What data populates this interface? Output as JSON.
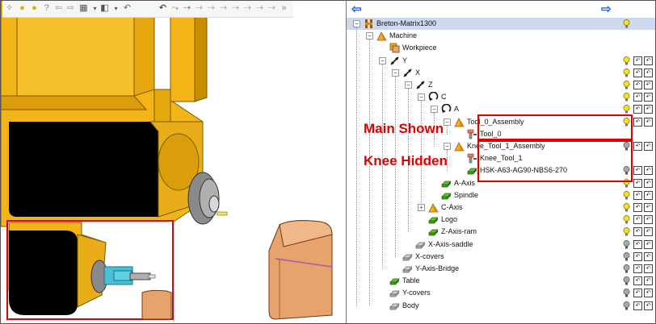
{
  "annotations": {
    "main_shown": "Main Shown",
    "knee_hidden": "Knee Hidden"
  },
  "toolbar": {
    "icons": [
      "camera-icon",
      "bulb-icon",
      "bulb-icon",
      "bulb-question-icon",
      "arrow-left-icon",
      "arrow-right-icon",
      "cube-grid-icon",
      "dropdown-arrow-icon",
      "select-cube-icon",
      "dropdown-arrow-icon",
      "undo-icon",
      "path-icon",
      "path-icon",
      "path-icon",
      "path-icon",
      "path-icon",
      "path-icon",
      "path-icon",
      "more-icon"
    ]
  },
  "tree": {
    "nav_back": "⇦",
    "nav_forward": "⇨",
    "nodes": [
      {
        "label": "Breton-Matrix1300",
        "icon": "machine-icon",
        "bulb": "on",
        "boxes": 0
      },
      {
        "label": "Machine",
        "icon": "component-icon",
        "bulb": "",
        "boxes": 0
      },
      {
        "label": "Workpiece",
        "icon": "workpiece-icon",
        "bulb": "",
        "boxes": 0
      },
      {
        "label": "Y",
        "icon": "linear-axis-icon",
        "bulb": "on",
        "boxes": 2
      },
      {
        "label": "X",
        "icon": "linear-axis-icon",
        "bulb": "on",
        "boxes": 2
      },
      {
        "label": "Z",
        "icon": "linear-axis-icon",
        "bulb": "on",
        "boxes": 2
      },
      {
        "label": "C",
        "icon": "rotary-axis-icon",
        "bulb": "on",
        "boxes": 2
      },
      {
        "label": "A",
        "icon": "rotary-axis-icon",
        "bulb": "on",
        "boxes": 2
      },
      {
        "label": "Tool_0_Assembly",
        "icon": "component-icon",
        "bulb": "on",
        "boxes": 2
      },
      {
        "label": "Tool_0",
        "icon": "tool-icon",
        "bulb": "",
        "boxes": 0
      },
      {
        "label": "Knee_Tool_1_Assembly",
        "icon": "component-icon",
        "bulb": "off",
        "boxes": 2
      },
      {
        "label": "Knee_Tool_1",
        "icon": "tool-icon",
        "bulb": "",
        "boxes": 0
      },
      {
        "label": "HSK-A63-AG90-NBS6-270",
        "icon": "green-solid-icon",
        "bulb": "off",
        "boxes": 2
      },
      {
        "label": "A-Axis",
        "icon": "green-solid-icon",
        "bulb": "on",
        "boxes": 2
      },
      {
        "label": "Spindle",
        "icon": "green-solid-icon",
        "bulb": "on",
        "boxes": 2
      },
      {
        "label": "C-Axis",
        "icon": "component-icon",
        "bulb": "on",
        "boxes": 2
      },
      {
        "label": "Logo",
        "icon": "green-solid-icon",
        "bulb": "on",
        "boxes": 2
      },
      {
        "label": "Z-Axis-ram",
        "icon": "green-solid-icon",
        "bulb": "on",
        "boxes": 2
      },
      {
        "label": "X-Axis-saddle",
        "icon": "grey-solid-icon",
        "bulb": "off",
        "boxes": 2
      },
      {
        "label": "X-covers",
        "icon": "grey-solid-icon",
        "bulb": "off",
        "boxes": 2
      },
      {
        "label": "Y-Axis-Bridge",
        "icon": "grey-solid-icon",
        "bulb": "off",
        "boxes": 2
      },
      {
        "label": "Table",
        "icon": "green-solid-icon",
        "bulb": "off",
        "boxes": 2
      },
      {
        "label": "Y-covers",
        "icon": "grey-solid-icon",
        "bulb": "off",
        "boxes": 2
      },
      {
        "label": "Body",
        "icon": "grey-solid-icon",
        "bulb": "off",
        "boxes": 2
      }
    ]
  },
  "colors": {
    "machine_yellow": "#f2b417",
    "machine_dark": "#c98d00",
    "highlight_red": "#e00000",
    "selection_blue": "#ccd9ef",
    "orange_tool": "#e8a26c"
  }
}
